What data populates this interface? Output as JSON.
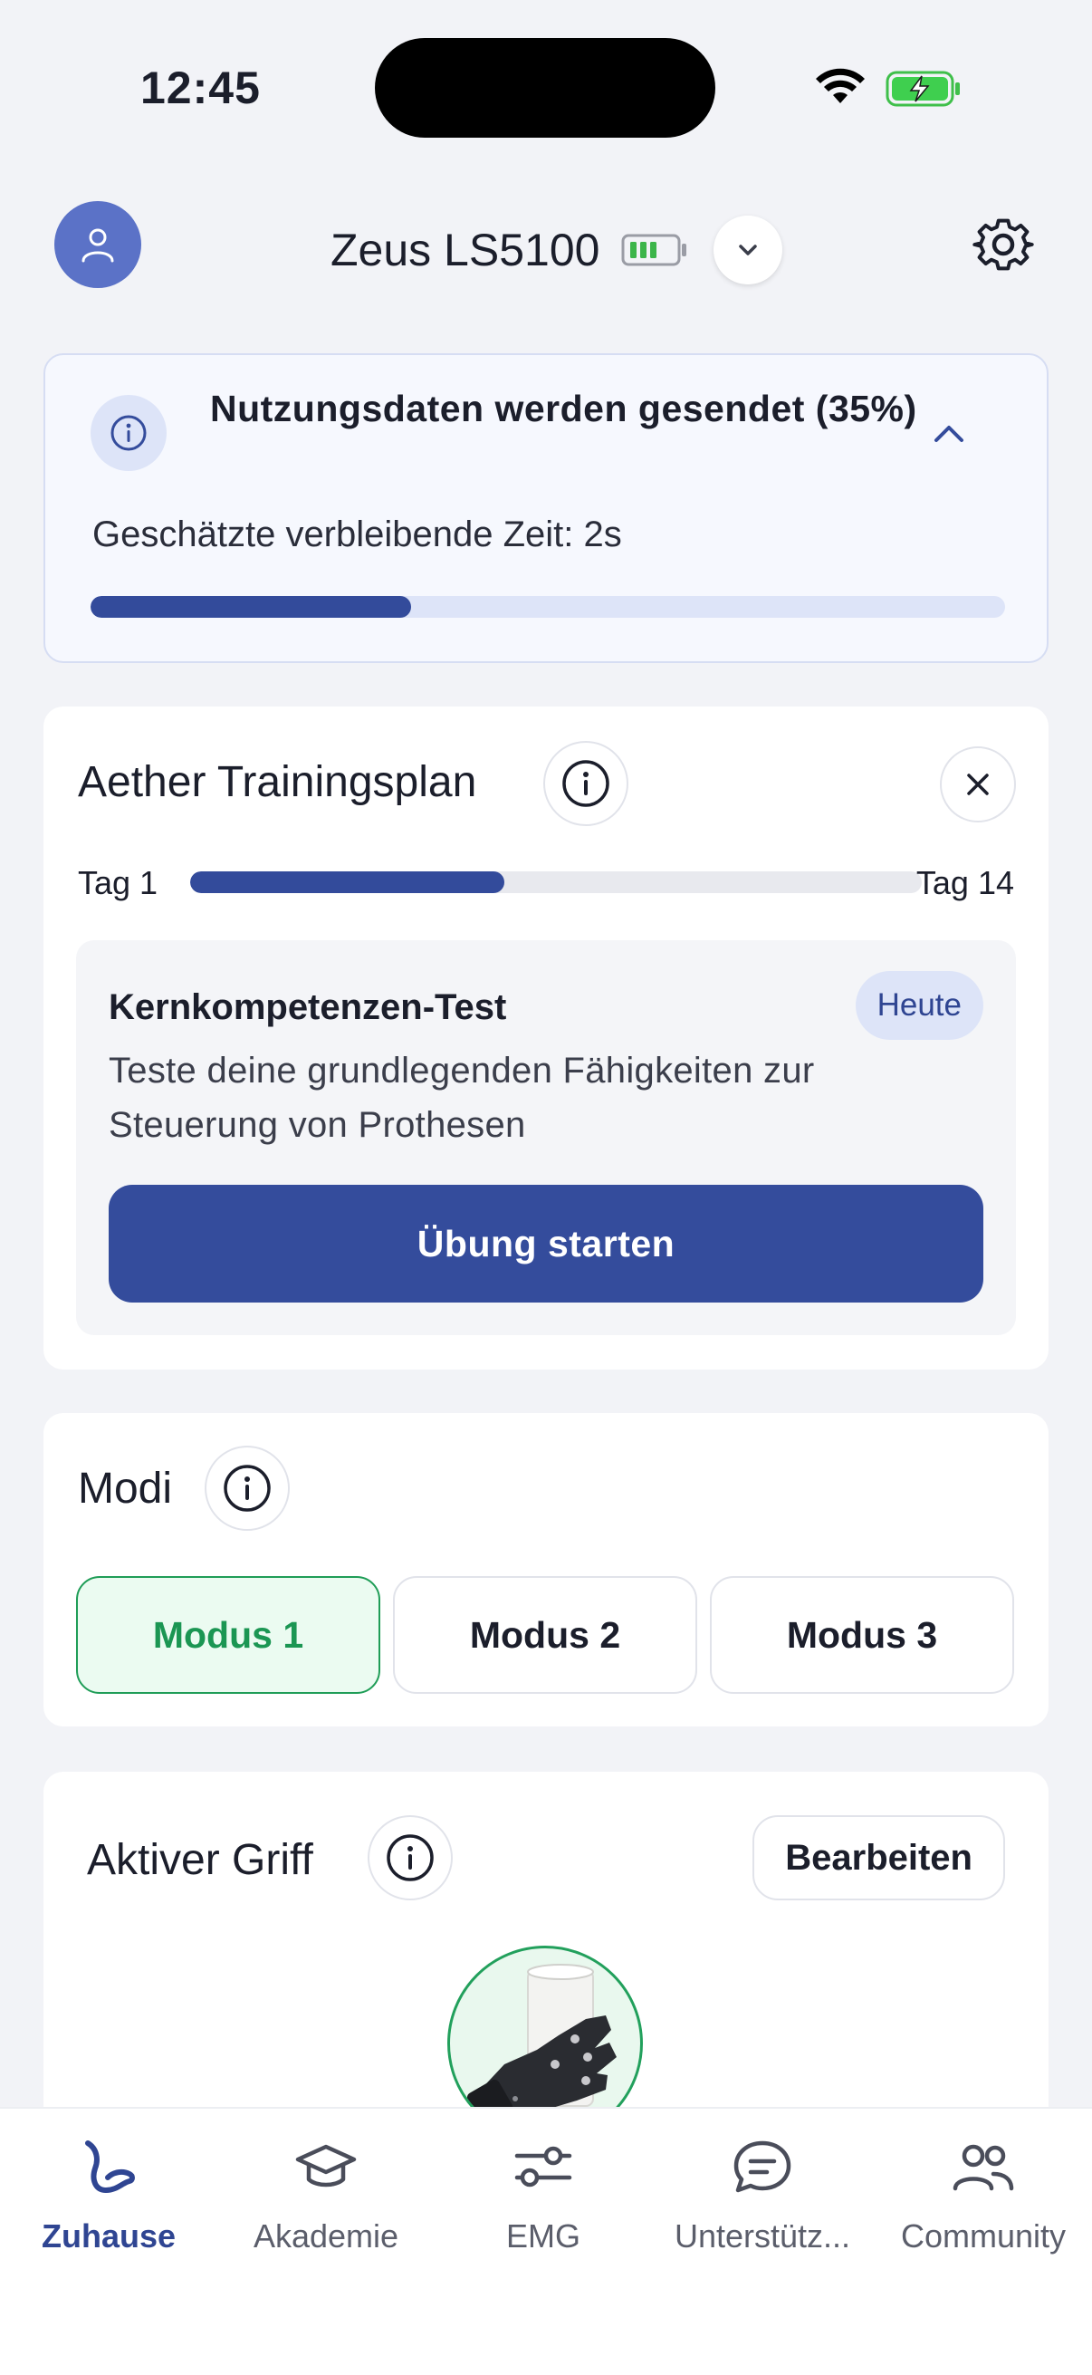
{
  "status_bar": {
    "time": "12:45"
  },
  "header": {
    "device_name": "Zeus LS5100"
  },
  "upload": {
    "title": "Nutzungsdaten werden gesendet (35%)",
    "eta": "Geschätzte verbleibende Zeit: 2s",
    "progress_percent": 35
  },
  "training": {
    "title": "Aether Trainingsplan",
    "day_start": "Tag 1",
    "day_end": "Tag 14",
    "progress_fraction": 0.43,
    "exercise": {
      "title": "Kernkompetenzen-Test",
      "badge": "Heute",
      "description": "Teste deine grundlegenden Fähigkeiten zur Steuerung von Prothesen",
      "start_label": "Übung starten"
    }
  },
  "modes": {
    "title": "Modi",
    "items": [
      {
        "label": "Modus 1",
        "selected": true
      },
      {
        "label": "Modus 2",
        "selected": false
      },
      {
        "label": "Modus 3",
        "selected": false
      }
    ]
  },
  "grip": {
    "title": "Aktiver Griff",
    "edit_label": "Bearbeiten"
  },
  "nav": {
    "items": [
      {
        "label": "Zuhause",
        "icon": "home-arm-icon",
        "active": true
      },
      {
        "label": "Akademie",
        "icon": "graduation-cap-icon",
        "active": false
      },
      {
        "label": "EMG",
        "icon": "sliders-icon",
        "active": false
      },
      {
        "label": "Unterstütz...",
        "icon": "chat-icon",
        "active": false
      },
      {
        "label": "Community",
        "icon": "users-icon",
        "active": false
      }
    ]
  },
  "colors": {
    "accent": "#344c9c",
    "success": "#1f9d57",
    "background": "#f2f3f7"
  }
}
